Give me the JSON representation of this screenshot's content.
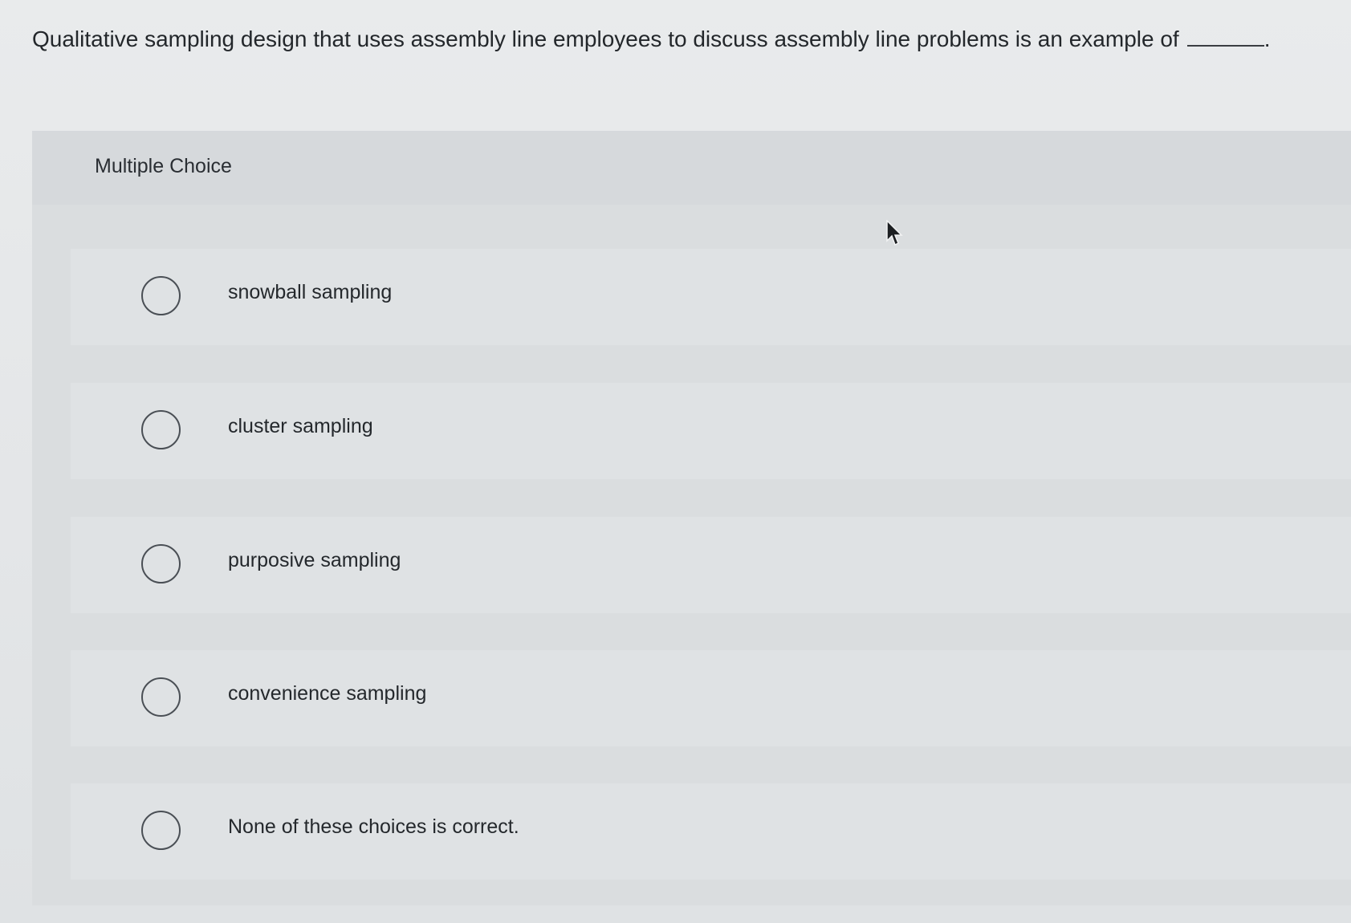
{
  "question": {
    "text": "Qualitative sampling design that uses assembly line employees to discuss assembly line problems is an example of",
    "end": "."
  },
  "multiple_choice": {
    "title": "Multiple Choice",
    "options": [
      {
        "label": "snowball sampling",
        "selected": false
      },
      {
        "label": "cluster sampling",
        "selected": false
      },
      {
        "label": "purposive sampling",
        "selected": false
      },
      {
        "label": "convenience sampling",
        "selected": false
      },
      {
        "label": "None of these choices is correct.",
        "selected": false
      }
    ]
  },
  "colors": {
    "radio_border": "#4a4f55",
    "text": "#24282c",
    "panel": "#dadddf"
  },
  "icons": {
    "cursor": "mouse-pointer-icon"
  }
}
